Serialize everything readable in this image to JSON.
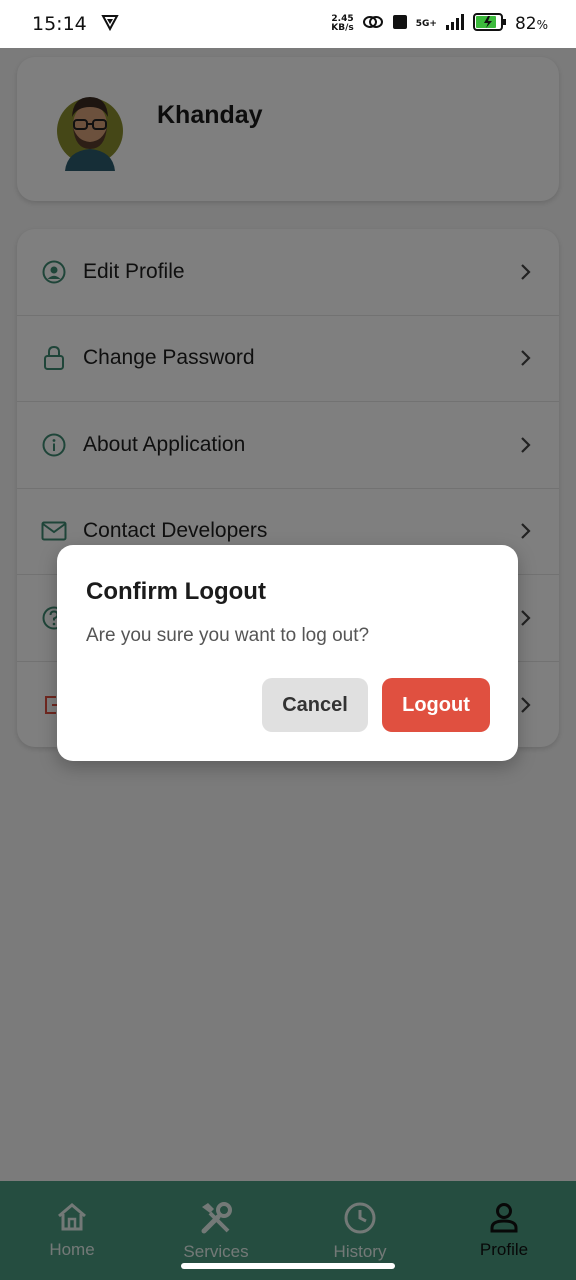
{
  "status_bar": {
    "time": "15:14",
    "net_speed_value": "2.45",
    "net_speed_unit": "KB/s",
    "network": "5G+",
    "battery": "82",
    "battery_unit": "%"
  },
  "profile": {
    "name": "Khanday"
  },
  "menu": {
    "items": [
      {
        "label": "Edit Profile",
        "icon": "user-circle-icon"
      },
      {
        "label": "Change Password",
        "icon": "lock-icon"
      },
      {
        "label": "About Application",
        "icon": "info-icon"
      },
      {
        "label": "Contact Developers",
        "icon": "mail-icon"
      },
      {
        "label": "",
        "icon": "help-icon"
      },
      {
        "label": "",
        "icon": "logout-icon"
      }
    ]
  },
  "dialog": {
    "title": "Confirm Logout",
    "message": "Are you sure you want to log out?",
    "cancel_label": "Cancel",
    "confirm_label": "Logout"
  },
  "bottom_nav": {
    "items": [
      {
        "label": "Home",
        "icon": "home-icon"
      },
      {
        "label": "Services",
        "icon": "tools-icon"
      },
      {
        "label": "History",
        "icon": "clock-icon"
      },
      {
        "label": "Profile",
        "icon": "person-icon"
      }
    ],
    "active": "Profile"
  },
  "colors": {
    "accent": "#4a9a80",
    "danger": "#e05040",
    "icon_teal": "#3f8a72"
  }
}
